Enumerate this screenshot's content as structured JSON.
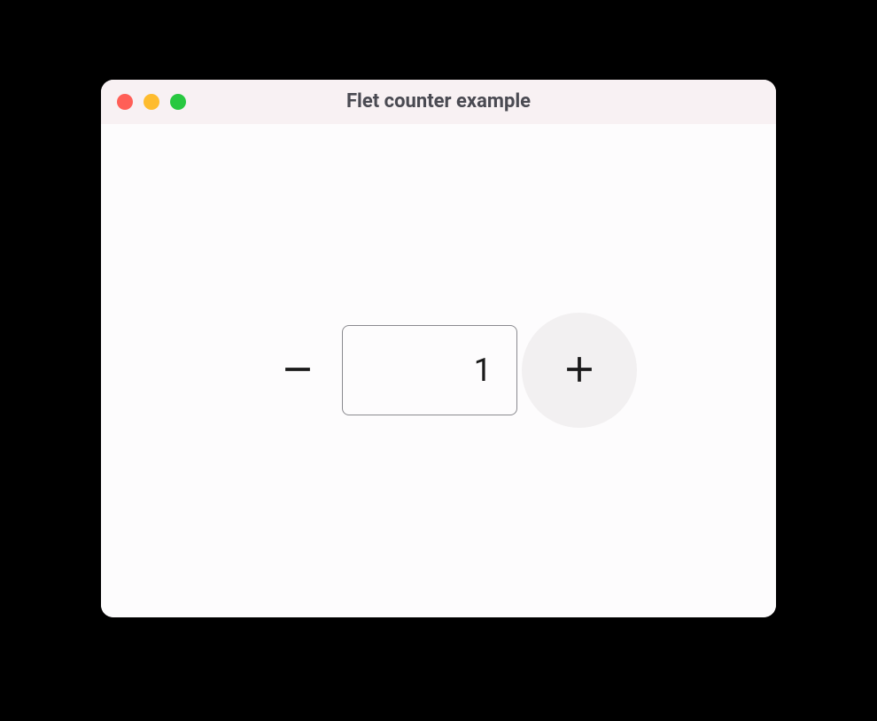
{
  "window": {
    "title": "Flet counter example"
  },
  "counter": {
    "value": "1",
    "minus_icon": "minus-icon",
    "plus_icon": "plus-icon"
  },
  "colors": {
    "close": "#ff5f57",
    "minimize": "#febc2e",
    "zoom": "#28c840"
  }
}
